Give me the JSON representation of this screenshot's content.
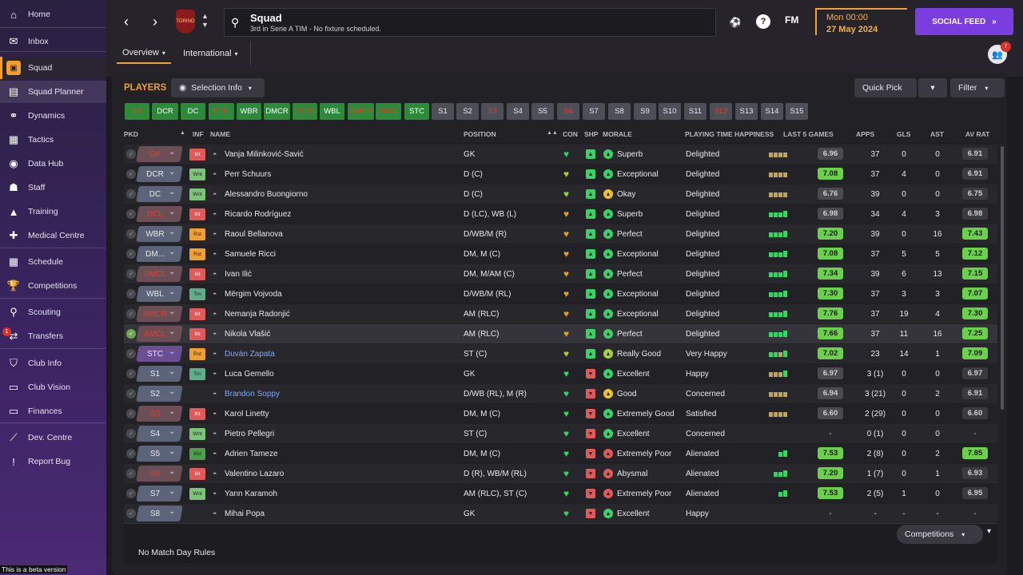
{
  "sidebar": {
    "items": [
      {
        "label": "Home",
        "icon": "home-icon"
      },
      {
        "label": "Inbox",
        "icon": "inbox-icon"
      },
      {
        "label": "Squad",
        "icon": "squad-icon"
      },
      {
        "label": "Squad Planner",
        "icon": "planner-icon"
      },
      {
        "label": "Dynamics",
        "icon": "dynamics-icon"
      },
      {
        "label": "Tactics",
        "icon": "tactics-icon"
      },
      {
        "label": "Data Hub",
        "icon": "datahub-icon"
      },
      {
        "label": "Staff",
        "icon": "staff-icon"
      },
      {
        "label": "Training",
        "icon": "training-icon"
      },
      {
        "label": "Medical Centre",
        "icon": "medical-icon"
      },
      {
        "label": "Schedule",
        "icon": "schedule-icon"
      },
      {
        "label": "Competitions",
        "icon": "trophy-icon"
      },
      {
        "label": "Scouting",
        "icon": "scouting-icon"
      },
      {
        "label": "Transfers",
        "icon": "transfers-icon"
      },
      {
        "label": "Club Info",
        "icon": "shield-icon"
      },
      {
        "label": "Club Vision",
        "icon": "vision-icon"
      },
      {
        "label": "Finances",
        "icon": "finances-icon"
      },
      {
        "label": "Dev. Centre",
        "icon": "devcentre-icon"
      },
      {
        "label": "Report Bug",
        "icon": "bug-icon"
      }
    ],
    "transfers_badge": "1",
    "beta": "This is a beta version"
  },
  "header": {
    "title": "Squad",
    "subtitle": "3rd in Serie A TIM - No fixture scheduled.",
    "crest_text": "TORINO",
    "fm_logo": "FM",
    "time": "Mon 00:00",
    "date": "27 May 2024",
    "social_feed": "SOCIAL FEED",
    "notif_count": "7"
  },
  "tabs": [
    "Overview",
    "International"
  ],
  "players_label": "PLAYERS",
  "selection_info": "Selection Info",
  "quick_pick": "Quick Pick",
  "filter": "Filter",
  "position_chips": [
    {
      "label": "GK",
      "style": "gr"
    },
    {
      "label": "DCR",
      "style": "g"
    },
    {
      "label": "DC",
      "style": "g"
    },
    {
      "label": "DCL",
      "style": "gr"
    },
    {
      "label": "WBR",
      "style": "g"
    },
    {
      "label": "DMCR",
      "style": "g"
    },
    {
      "label": "DMCL",
      "style": "gr"
    },
    {
      "label": "WBL",
      "style": "g"
    },
    {
      "label": "AMCR",
      "style": "gr"
    },
    {
      "label": "AMCL",
      "style": "gr"
    },
    {
      "label": "STC",
      "style": "g"
    },
    {
      "label": "S1",
      "style": "s"
    },
    {
      "label": "S2",
      "style": "s"
    },
    {
      "label": "S3",
      "style": "sr"
    },
    {
      "label": "S4",
      "style": "s"
    },
    {
      "label": "S5",
      "style": "s"
    },
    {
      "label": "S6",
      "style": "sr"
    },
    {
      "label": "S7",
      "style": "s"
    },
    {
      "label": "S8",
      "style": "s"
    },
    {
      "label": "S9",
      "style": "s"
    },
    {
      "label": "S10",
      "style": "s"
    },
    {
      "label": "S11",
      "style": "s"
    },
    {
      "label": "S12",
      "style": "sr"
    },
    {
      "label": "S13",
      "style": "s"
    },
    {
      "label": "S14",
      "style": "s"
    },
    {
      "label": "S15",
      "style": "s"
    }
  ],
  "columns": {
    "pkd": "PKD",
    "inf": "INF",
    "name": "NAME",
    "position": "POSITION",
    "con": "CON",
    "shp": "SHP",
    "morale": "MORALE",
    "pth": "PLAYING TIME HAPPINESS",
    "last5": "LAST 5 GAMES",
    "apps": "APPS",
    "gls": "GLS",
    "ast": "AST",
    "avrat": "AV RAT"
  },
  "players": [
    {
      "pk": "GK",
      "pk_red": true,
      "inf": "Int",
      "inf_type": "int",
      "name": "Vanja Milinković-Savić",
      "pos": "GK",
      "con": "#3ad06a",
      "shp": "#3ad06a",
      "shp_up": true,
      "mor_color": "#3ad06a",
      "morale": "Superb",
      "pth": "Delighted",
      "bars": [
        "#b9a46a",
        "#b9a46a",
        "#b9a46a",
        "#b9a46a"
      ],
      "last5": "6.96",
      "last5_col": "#d0d0d0",
      "apps": "37",
      "gls": "0",
      "ast": "0",
      "av": "6.91",
      "av_col": "#d0d0d0"
    },
    {
      "pk": "DCR",
      "pk_red": false,
      "inf": "Wnt",
      "inf_type": "wnt",
      "name": "Perr Schuurs",
      "pos": "D (C)",
      "con": "#b8c83a",
      "shp": "#3ad06a",
      "shp_up": true,
      "mor_color": "#3ad06a",
      "morale": "Exceptional",
      "pth": "Delighted",
      "bars": [
        "#b9a46a",
        "#b9a46a",
        "#b9a46a",
        "#b9a46a"
      ],
      "last5": "7.08",
      "last5_col": "#6bd04a",
      "apps": "37",
      "gls": "4",
      "ast": "0",
      "av": "6.91",
      "av_col": "#d0d0d0"
    },
    {
      "pk": "DC",
      "pk_red": false,
      "inf": "Wnt",
      "inf_type": "wnt",
      "name": "Alessandro Buongiorno",
      "pos": "D (C)",
      "con": "#8ad84a",
      "shp": "#3ad06a",
      "shp_up": true,
      "mor_color": "#f0c030",
      "morale": "Okay",
      "pth": "Delighted",
      "bars": [
        "#b9a46a",
        "#b9a46a",
        "#b9a46a",
        "#b9a46a"
      ],
      "last5": "6.76",
      "last5_col": "#d0d0d0",
      "apps": "39",
      "gls": "0",
      "ast": "0",
      "av": "6.75",
      "av_col": "#d0d0d0"
    },
    {
      "pk": "DCL",
      "pk_red": true,
      "inf": "Int",
      "inf_type": "int",
      "name": "Ricardo Rodríguez",
      "pos": "D (LC), WB (L)",
      "con": "#e0a030",
      "shp": "#3ad06a",
      "shp_up": true,
      "mor_color": "#3ad06a",
      "morale": "Superb",
      "pth": "Delighted",
      "bars": [
        "#3ad06a",
        "#3ad06a",
        "#3ad06a",
        "#3ad06a"
      ],
      "last5": "6.98",
      "last5_col": "#d0d0d0",
      "apps": "34",
      "gls": "4",
      "ast": "3",
      "av": "6.98",
      "av_col": "#d0d0d0"
    },
    {
      "pk": "WBR",
      "pk_red": false,
      "inf": "Rst",
      "inf_type": "rst",
      "name": "Raoul Bellanova",
      "pos": "D/WB/M (R)",
      "con": "#e0a030",
      "shp": "#3ad06a",
      "shp_up": true,
      "mor_color": "#3ad06a",
      "morale": "Perfect",
      "pth": "Delighted",
      "bars": [
        "#3ad06a",
        "#3ad06a",
        "#3ad06a",
        "#3ad06a"
      ],
      "last5": "7.20",
      "last5_col": "#6bd04a",
      "apps": "39",
      "gls": "0",
      "ast": "16",
      "av": "7.43",
      "av_col": "#6bd04a"
    },
    {
      "pk": "DM...",
      "pk_red": false,
      "inf": "Rst",
      "inf_type": "rst",
      "name": "Samuele Ricci",
      "pos": "DM, M (C)",
      "con": "#e0a030",
      "shp": "#3ad06a",
      "shp_up": true,
      "mor_color": "#3ad06a",
      "morale": "Exceptional",
      "pth": "Delighted",
      "bars": [
        "#3ad06a",
        "#3ad06a",
        "#3ad06a",
        "#3ad06a"
      ],
      "last5": "7.08",
      "last5_col": "#6bd04a",
      "apps": "37",
      "gls": "5",
      "ast": "5",
      "av": "7.12",
      "av_col": "#6bd04a"
    },
    {
      "pk": "DMCL",
      "pk_red": true,
      "inf": "Int",
      "inf_type": "int",
      "name": "Ivan Ilić",
      "pos": "DM, M/AM (C)",
      "con": "#e0a030",
      "shp": "#3ad06a",
      "shp_up": true,
      "mor_color": "#3ad06a",
      "morale": "Perfect",
      "pth": "Delighted",
      "bars": [
        "#3ad06a",
        "#3ad06a",
        "#3ad06a",
        "#3ad06a"
      ],
      "last5": "7.34",
      "last5_col": "#6bd04a",
      "apps": "39",
      "gls": "6",
      "ast": "13",
      "av": "7.15",
      "av_col": "#6bd04a"
    },
    {
      "pk": "WBL",
      "pk_red": false,
      "inf": "Trn",
      "inf_type": "trn",
      "name": "Mërgim Vojvoda",
      "pos": "D/WB/M (RL)",
      "con": "#e0a030",
      "shp": "#3ad06a",
      "shp_up": true,
      "mor_color": "#3ad06a",
      "morale": "Exceptional",
      "pth": "Delighted",
      "bars": [
        "#3ad06a",
        "#3ad06a",
        "#3ad06a",
        "#3ad06a"
      ],
      "last5": "7.30",
      "last5_col": "#6bd04a",
      "apps": "37",
      "gls": "3",
      "ast": "3",
      "av": "7.07",
      "av_col": "#6bd04a"
    },
    {
      "pk": "AMCR",
      "pk_red": true,
      "inf": "Int",
      "inf_type": "int",
      "name": "Nemanja Radonjić",
      "pos": "AM (RLC)",
      "con": "#e0a030",
      "shp": "#3ad06a",
      "shp_up": true,
      "mor_color": "#3ad06a",
      "morale": "Exceptional",
      "pth": "Delighted",
      "bars": [
        "#3ad06a",
        "#3ad06a",
        "#3ad06a",
        "#3ad06a"
      ],
      "last5": "7.76",
      "last5_col": "#6bd04a",
      "apps": "37",
      "gls": "19",
      "ast": "4",
      "av": "7.30",
      "av_col": "#6bd04a"
    },
    {
      "pk": "AMCL",
      "pk_red": true,
      "inf": "Int",
      "inf_type": "int",
      "name": "Nikola Vlašić",
      "pos": "AM (RLC)",
      "con": "#e0a030",
      "shp": "#3ad06a",
      "shp_up": true,
      "mor_color": "#3ad06a",
      "morale": "Perfect",
      "pth": "Delighted",
      "bars": [
        "#3ad06a",
        "#3ad06a",
        "#3ad06a",
        "#3ad06a"
      ],
      "last5": "7.66",
      "last5_col": "#6bd04a",
      "apps": "37",
      "gls": "11",
      "ast": "16",
      "av": "7.25",
      "av_col": "#6bd04a",
      "selected": true
    },
    {
      "pk": "STC",
      "pk_red": false,
      "pur": true,
      "inf": "Rst",
      "inf_type": "rst",
      "name": "Duván Zapata",
      "blue": true,
      "pos": "ST (C)",
      "con": "#b8c83a",
      "shp": "#3ad06a",
      "shp_up": true,
      "mor_color": "#a8d040",
      "morale": "Really Good",
      "pth": "Very Happy",
      "bars": [
        "#3ad06a",
        "#3ad06a",
        "#b9a46a",
        "#3ad06a"
      ],
      "last5": "7.02",
      "last5_col": "#6bd04a",
      "apps": "23",
      "gls": "14",
      "ast": "1",
      "av": "7.09",
      "av_col": "#6bd04a"
    },
    {
      "pk": "S1",
      "pk_red": false,
      "inf": "Trn",
      "inf_type": "trn",
      "name": "Luca Gemello",
      "pos": "GK",
      "con": "#3ad06a",
      "shp": "#e05a5a",
      "shp_up": false,
      "mor_color": "#3ad06a",
      "morale": "Excellent",
      "pth": "Happy",
      "bars": [
        "#b9a46a",
        "#b9a46a",
        "#b9a46a",
        "#3ad06a"
      ],
      "last5": "6.97",
      "last5_col": "#d0d0d0",
      "apps": "3 (1)",
      "gls": "0",
      "ast": "0",
      "av": "6.97",
      "av_col": "#d0d0d0"
    },
    {
      "pk": "S2",
      "pk_red": false,
      "inf": "",
      "inf_type": "",
      "name": "Brandon Soppy",
      "blue": true,
      "pos": "D/WB (RL), M (R)",
      "con": "#3ad06a",
      "shp": "#e05a5a",
      "shp_up": false,
      "mor_color": "#f0c030",
      "morale": "Good",
      "pth": "Concerned",
      "bars": [
        "#b9a46a",
        "#b9a46a",
        "#b9a46a",
        "#b9a46a"
      ],
      "last5": "6.94",
      "last5_col": "#d0d0d0",
      "apps": "3 (21)",
      "gls": "0",
      "ast": "2",
      "av": "6.91",
      "av_col": "#d0d0d0"
    },
    {
      "pk": "S3",
      "pk_red": true,
      "inf": "Int",
      "inf_type": "int",
      "name": "Karol Linetty",
      "pos": "DM, M (C)",
      "con": "#3ad06a",
      "shp": "#e05a5a",
      "shp_up": false,
      "mor_color": "#3ad06a",
      "morale": "Extremely Good",
      "pth": "Satisfied",
      "bars": [
        "#b9a46a",
        "#b9a46a",
        "#b9a46a",
        "#b9a46a"
      ],
      "last5": "6.60",
      "last5_col": "#d0d0d0",
      "apps": "2 (29)",
      "gls": "0",
      "ast": "0",
      "av": "6.60",
      "av_col": "#d0d0d0"
    },
    {
      "pk": "S4",
      "pk_red": false,
      "inf": "Wnt",
      "inf_type": "wnt",
      "name": "Pietro Pellegri",
      "pos": "ST (C)",
      "con": "#3ad06a",
      "shp": "#e05a5a",
      "shp_up": false,
      "mor_color": "#3ad06a",
      "morale": "Excellent",
      "pth": "Concerned",
      "bars": [],
      "last5": "-",
      "last5_col": "none",
      "apps": "0 (1)",
      "gls": "0",
      "ast": "0",
      "av": "-",
      "av_col": "none"
    },
    {
      "pk": "S5",
      "pk_red": false,
      "inf": "Bid",
      "inf_type": "bid",
      "name": "Adrien Tameze",
      "pos": "DM, M (C)",
      "con": "#3ad06a",
      "shp": "#e05a5a",
      "shp_up": false,
      "mor_color": "#e05a5a",
      "morale": "Extremely Poor",
      "pth": "Alienated",
      "bars": [
        "#3ad06a",
        "#3ad06a"
      ],
      "last5": "7.53",
      "last5_col": "#6bd04a",
      "apps": "2 (8)",
      "gls": "0",
      "ast": "2",
      "av": "7.85",
      "av_col": "#6bd04a"
    },
    {
      "pk": "S6",
      "pk_red": true,
      "inf": "Int",
      "inf_type": "int",
      "name": "Valentino Lazaro",
      "pos": "D (R), WB/M (RL)",
      "con": "#3ad06a",
      "shp": "#e05a5a",
      "shp_up": false,
      "mor_color": "#e05a5a",
      "morale": "Abysmal",
      "pth": "Alienated",
      "bars": [
        "#3ad06a",
        "#3ad06a",
        "#3ad06a"
      ],
      "last5": "7.20",
      "last5_col": "#6bd04a",
      "apps": "1 (7)",
      "gls": "0",
      "ast": "1",
      "av": "6.93",
      "av_col": "#d0d0d0"
    },
    {
      "pk": "S7",
      "pk_red": false,
      "inf": "Wnt",
      "inf_type": "wnt",
      "name": "Yann Karamoh",
      "pos": "AM (RLC), ST (C)",
      "con": "#3ad06a",
      "shp": "#e05a5a",
      "shp_up": false,
      "mor_color": "#e05a5a",
      "morale": "Extremely Poor",
      "pth": "Alienated",
      "bars": [
        "#3ad06a",
        "#3ad06a"
      ],
      "last5": "7.53",
      "last5_col": "#6bd04a",
      "apps": "2 (5)",
      "gls": "1",
      "ast": "0",
      "av": "6.95",
      "av_col": "#d0d0d0"
    },
    {
      "pk": "S8",
      "pk_red": false,
      "inf": "",
      "inf_type": "",
      "name": "Mihai Popa",
      "pos": "GK",
      "con": "#3ad06a",
      "shp": "#e05a5a",
      "shp_up": false,
      "mor_color": "#3ad06a",
      "morale": "Excellent",
      "pth": "Happy",
      "bars": [],
      "last5": "-",
      "last5_col": "none",
      "apps": "-",
      "gls": "-",
      "ast": "-",
      "av": "-",
      "av_col": "none"
    }
  ],
  "footer": {
    "competitions": "Competitions",
    "text": "No Match Day Rules"
  }
}
